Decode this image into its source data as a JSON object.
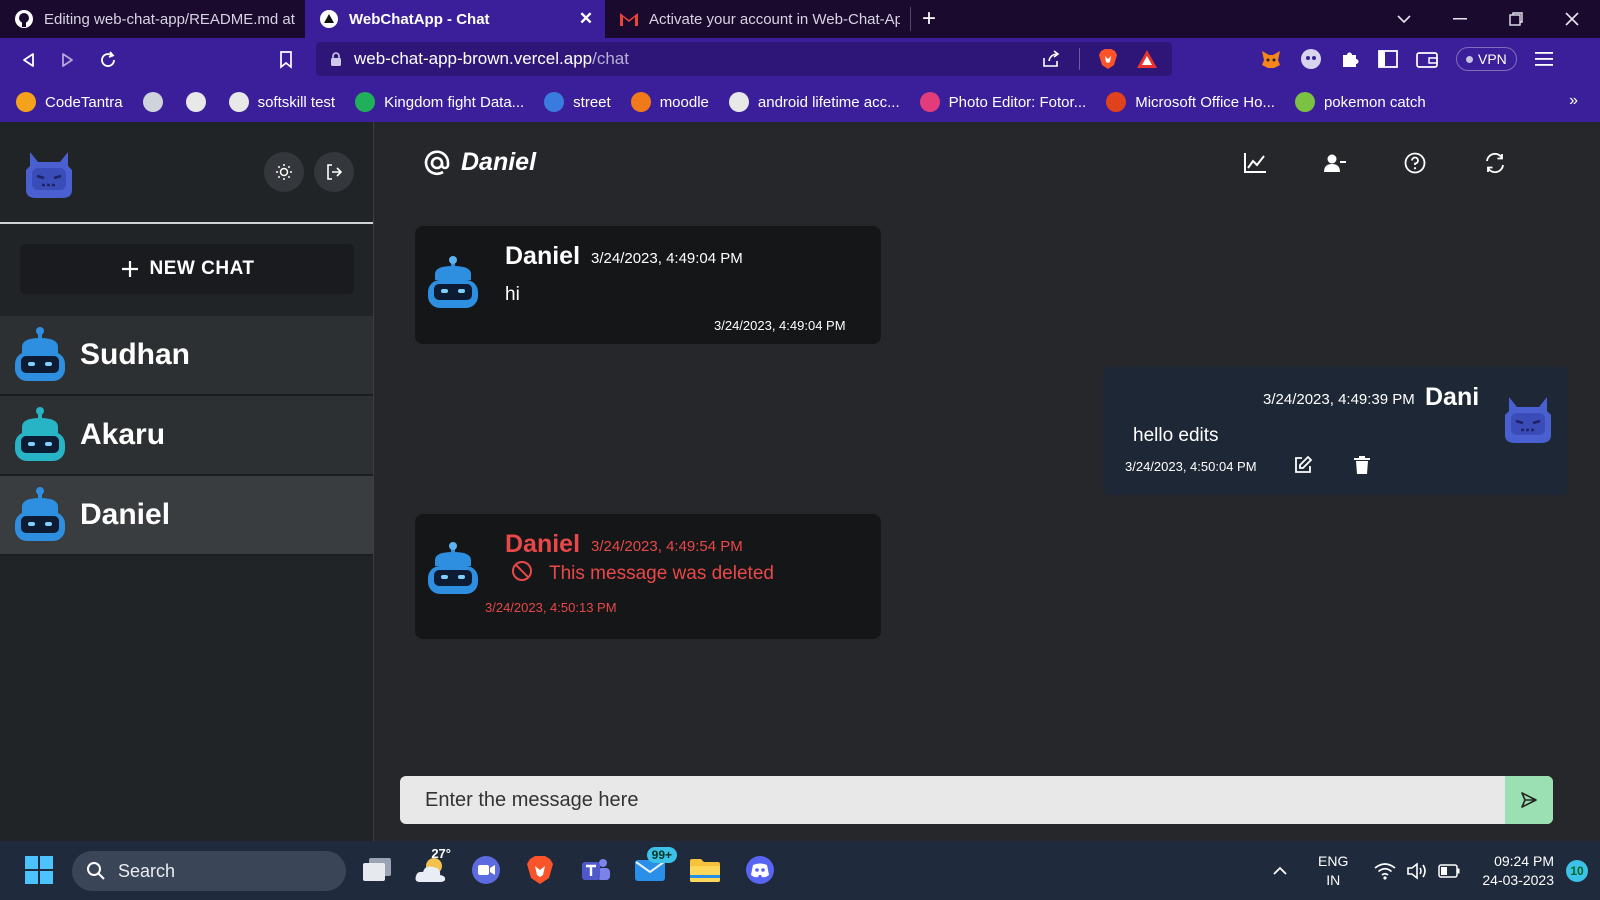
{
  "browser": {
    "tabs": [
      {
        "title": "Editing web-chat-app/README.md at",
        "icon": "github-icon"
      },
      {
        "title": "WebChatApp - Chat",
        "icon": "vercel-icon",
        "active": true
      },
      {
        "title": "Activate your account in Web-Chat-Ap",
        "icon": "gmail-icon"
      }
    ],
    "new_tab_label": "+",
    "url_host": "web-chat-app-brown.vercel.app",
    "url_path": "/chat",
    "vpn_label": "VPN",
    "bookmarks": [
      {
        "label": "CodeTantra",
        "color": "#f4a21c"
      },
      {
        "label": "",
        "color": "#cfd3dc"
      },
      {
        "label": "",
        "color": "#e8e8e8"
      },
      {
        "label": "softskill test",
        "color": "#e8e8e8"
      },
      {
        "label": "Kingdom fight Data...",
        "color": "#21b05a"
      },
      {
        "label": "street",
        "color": "#3a7be0"
      },
      {
        "label": "moodle",
        "color": "#f07a1a"
      },
      {
        "label": "android lifetime acc...",
        "color": "#e8e8e8"
      },
      {
        "label": "Photo Editor: Fotor...",
        "color": "#e23c7a"
      },
      {
        "label": "Microsoft Office Ho...",
        "color": "#e0421c"
      },
      {
        "label": "pokemon catch",
        "color": "#7cc242"
      }
    ],
    "bookmarks_more": "»"
  },
  "sidebar": {
    "new_chat_label": "NEW CHAT",
    "chats": [
      {
        "name": "Sudhan",
        "color": "#2e8fe0"
      },
      {
        "name": "Akaru",
        "color": "#27b4c4"
      },
      {
        "name": "Daniel",
        "color": "#2e8fe0",
        "selected": true
      }
    ]
  },
  "chat": {
    "header_name": "Daniel",
    "composer_placeholder": "Enter the message here",
    "messages": [
      {
        "sender": "Daniel",
        "timestamp": "3/24/2023, 4:49:04 PM",
        "text": "hi",
        "edited_time": "3/24/2023, 4:49:04 PM"
      },
      {
        "sender": "Dani",
        "timestamp": "3/24/2023, 4:49:39 PM",
        "text": "hello edits",
        "edited_time": "3/24/2023, 4:50:04 PM"
      },
      {
        "sender": "Daniel",
        "timestamp": "3/24/2023, 4:49:54 PM",
        "text": "This message was deleted",
        "edited_time": "3/24/2023, 4:50:13 PM",
        "deleted": true
      }
    ]
  },
  "taskbar": {
    "search_label": "Search",
    "weather_temp": "27°",
    "mail_badge": "99+",
    "lang_line1": "ENG",
    "lang_line2": "IN",
    "time": "09:24 PM",
    "date": "24-03-2023",
    "notification_count": "10"
  },
  "colors": {
    "browser_accent": "#3b1f9a",
    "deleted_red": "#e84848",
    "send_green": "#9be0b2"
  }
}
